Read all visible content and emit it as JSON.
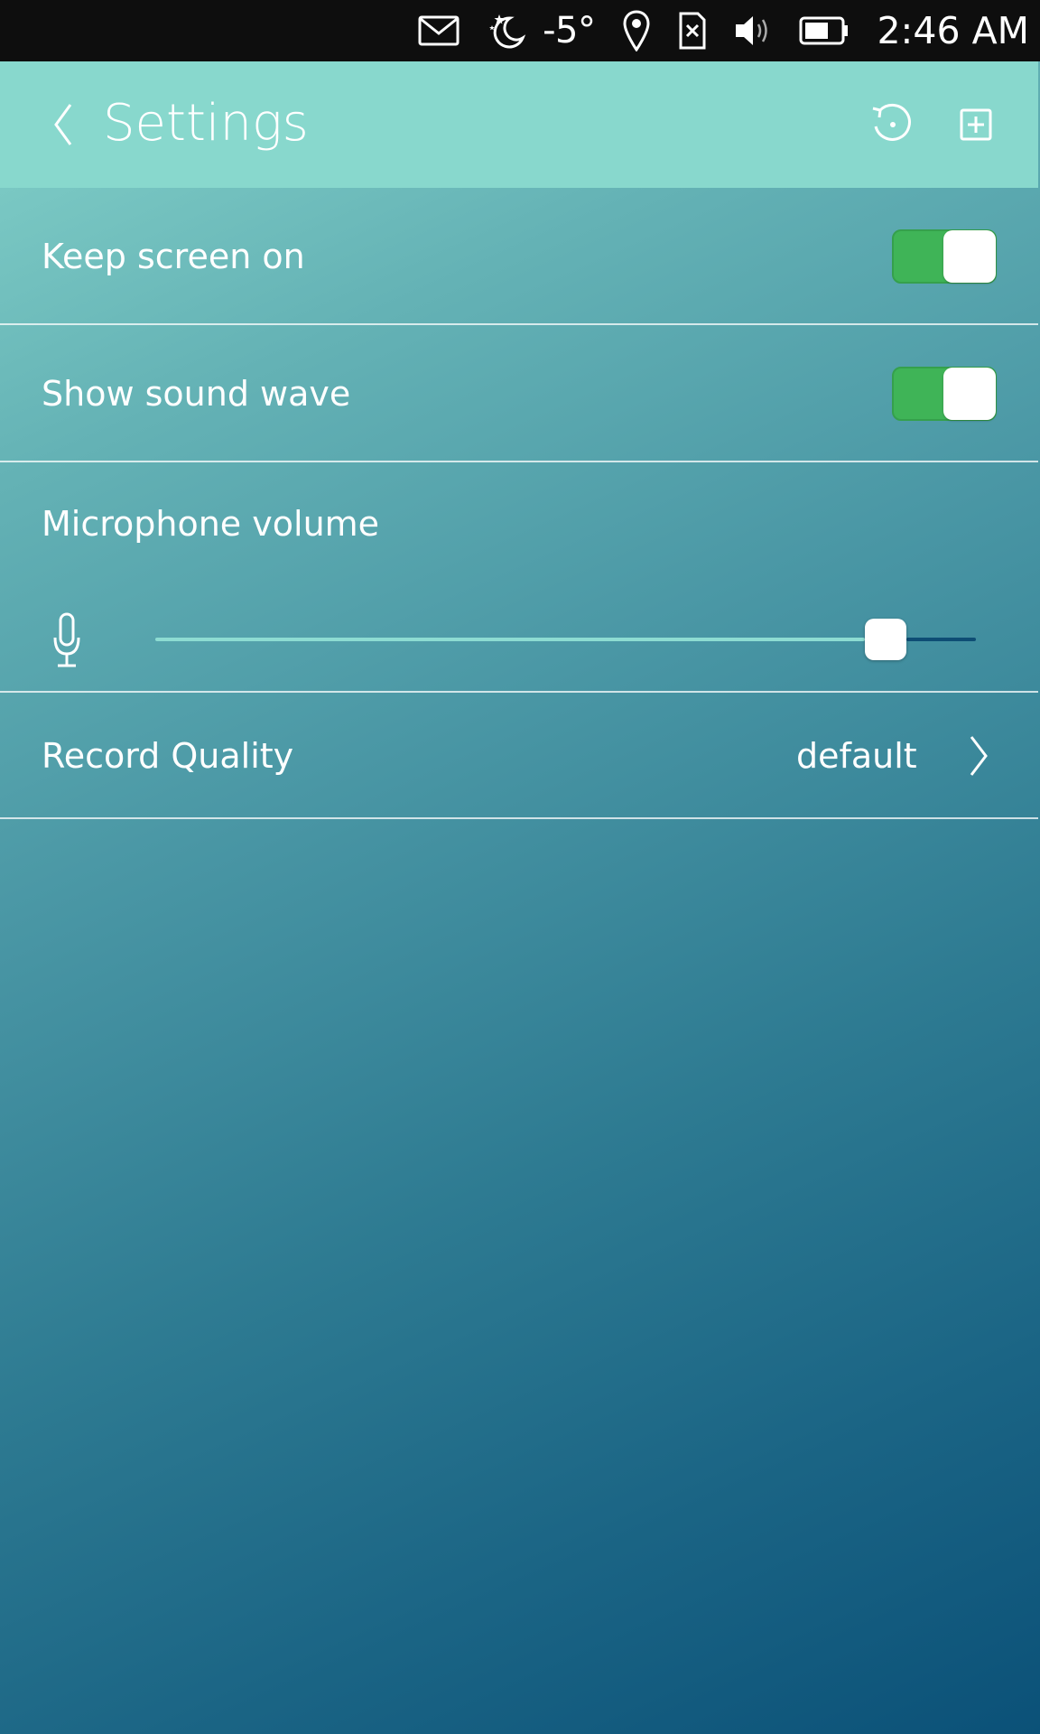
{
  "status_bar": {
    "icons": [
      "mail-icon",
      "night-moon-icon",
      "location-pin-icon",
      "no-sim-icon",
      "volume-icon",
      "battery-icon"
    ],
    "temperature": "-5°",
    "time": "2:46 AM"
  },
  "header": {
    "title": "Settings",
    "back_icon": "chevron-left-icon",
    "actions": [
      "reset-icon",
      "add-icon"
    ]
  },
  "settings": {
    "keep_screen_on": {
      "label": "Keep screen on",
      "enabled": true
    },
    "show_sound_wave": {
      "label": "Show sound wave",
      "enabled": true
    },
    "microphone_volume": {
      "label": "Microphone volume",
      "icon": "microphone-icon",
      "level_fraction": 0.89
    },
    "record_quality": {
      "label": "Record Quality",
      "value": "default",
      "icon": "chevron-right-icon"
    }
  },
  "colors": {
    "header_bg": "#88d8cd",
    "toggle_on": "#3fb457",
    "slider_fill": "#8ddcd2",
    "slider_rest": "#0e4d74"
  }
}
